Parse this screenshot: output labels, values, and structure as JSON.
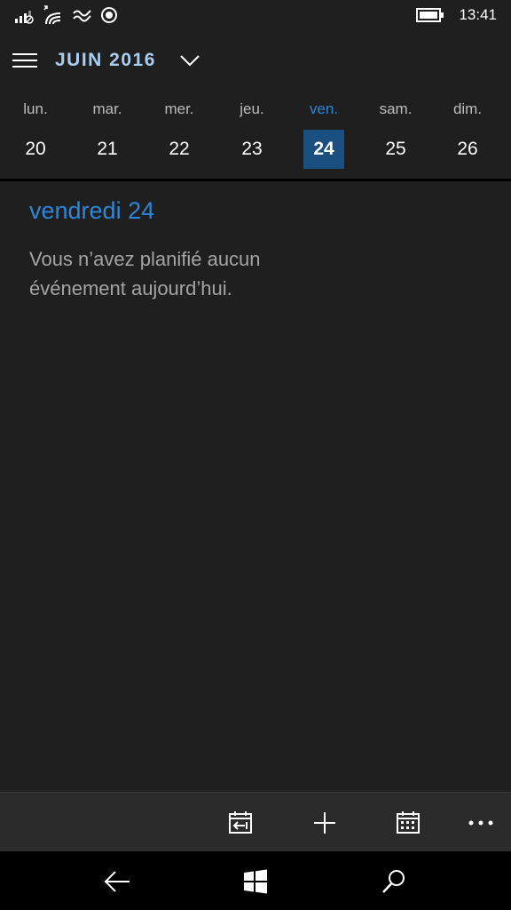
{
  "status_bar": {
    "time": "13:41",
    "icons": [
      "signal-icon",
      "mobile-data-icon",
      "wifi-icon",
      "nfc-icon",
      "location-icon",
      "battery-icon"
    ]
  },
  "header": {
    "title": "JUIN 2016",
    "menu_icon": "hamburger-icon",
    "dropdown_icon": "chevron-down-icon"
  },
  "week": {
    "days": [
      {
        "name": "lun.",
        "num": "20"
      },
      {
        "name": "mar.",
        "num": "21"
      },
      {
        "name": "mer.",
        "num": "22"
      },
      {
        "name": "jeu.",
        "num": "23"
      },
      {
        "name": "ven.",
        "num": "24"
      },
      {
        "name": "sam.",
        "num": "25"
      },
      {
        "name": "dim.",
        "num": "26"
      }
    ],
    "selected_index": 4
  },
  "agenda": {
    "heading": "vendredi 24",
    "empty_message": "Vous n’avez planifié aucun événement aujourd’hui."
  },
  "app_bar": {
    "buttons": [
      "today-icon",
      "add-icon",
      "calendar-view-icon",
      "more-icon"
    ]
  },
  "nav_bar": {
    "buttons": [
      "back-icon",
      "windows-start-icon",
      "search-icon"
    ]
  },
  "colors": {
    "background": "#1f1f1f",
    "accent": "#2e86d9",
    "selected_day": "#1b4f80",
    "title": "#a9cdf0",
    "app_bar": "#2b2b2b"
  }
}
